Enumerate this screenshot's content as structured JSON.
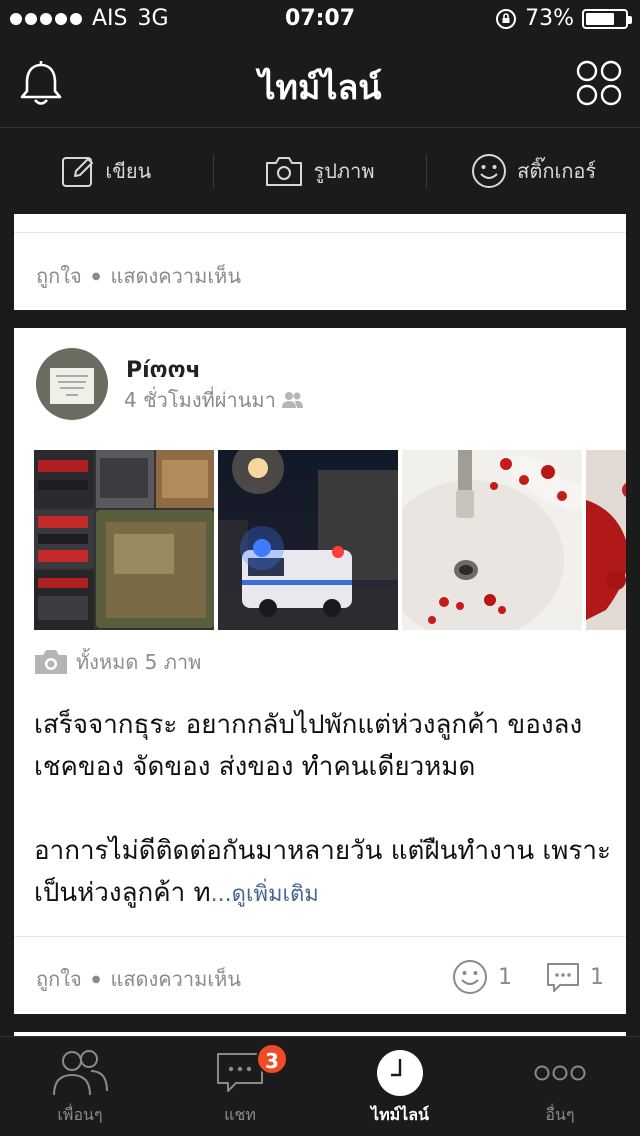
{
  "status": {
    "carrier": "AIS",
    "network": "3G",
    "time": "07:07",
    "battery": "73%",
    "battery_level": 0.73
  },
  "header": {
    "title": "ไทม์ไลน์",
    "left_icon": "bell-icon",
    "right_icon": "grid-icon"
  },
  "compose": [
    {
      "label": "เขียน",
      "icon": "pencil-icon"
    },
    {
      "label": "รูปภาพ",
      "icon": "camera-icon"
    },
    {
      "label": "สติ๊กเกอร์",
      "icon": "smiley-icon"
    }
  ],
  "prev_post": {
    "like": "ถูกใจ",
    "comment": "แสดงความเห็น"
  },
  "post": {
    "author": "Píოოч",
    "time": "4 ชั่วโมงที่ผ่านมา",
    "photo_count": "ทั้งหมด 5 ภาพ",
    "text1": "เสร็จจากธุระ อยากกลับไปพักแต่ห่วงลูกค้า ของลง เชคของ จัดของ ส่งของ ทำคนเดียวหมด",
    "text2": "อาการไม่ดีติดต่อกันมาหลายวัน แต่ฝืนทำงาน เพราะ เป็นห่วงลูกค้า ท",
    "see_more": "...ดูเพิ่มเติม",
    "like": "ถูกใจ",
    "comment": "แสดงความเห็น",
    "like_count": "1",
    "comment_count": "1"
  },
  "tabs": [
    {
      "label": "เพื่อนๆ",
      "icon": "friends-icon"
    },
    {
      "label": "แชท",
      "icon": "chat-icon",
      "badge": "3"
    },
    {
      "label": "ไทม์ไลน์",
      "icon": "clock-icon",
      "active": true
    },
    {
      "label": "อื่นๆ",
      "icon": "more-icon"
    }
  ],
  "colors": {
    "background": "#1b1b1b",
    "card": "#ffffff",
    "badge": "#ef4b24",
    "link": "#4a6592"
  }
}
